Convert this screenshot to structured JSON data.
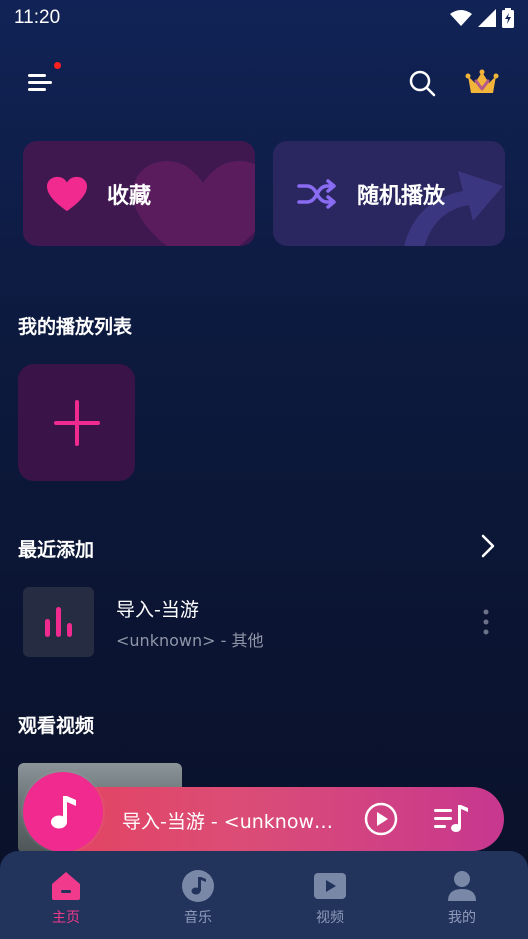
{
  "status_bar": {
    "time": "11:20"
  },
  "cards": {
    "favorites": "收藏",
    "shuffle": "随机播放"
  },
  "sections": {
    "playlists": "我的播放列表",
    "recently_added": "最近添加",
    "watch_video": "观看视频"
  },
  "recent_song": {
    "title": "导入-当游",
    "subtitle": "<unknown> - 其他"
  },
  "player": {
    "now_playing": "导入-当游 - <unknown>"
  },
  "nav": {
    "home": "主页",
    "music": "音乐",
    "video": "视频",
    "mine": "我的"
  },
  "colors": {
    "accent": "#f13a8c",
    "background": "#0d1a3f",
    "nav_bg": "#22335c"
  }
}
